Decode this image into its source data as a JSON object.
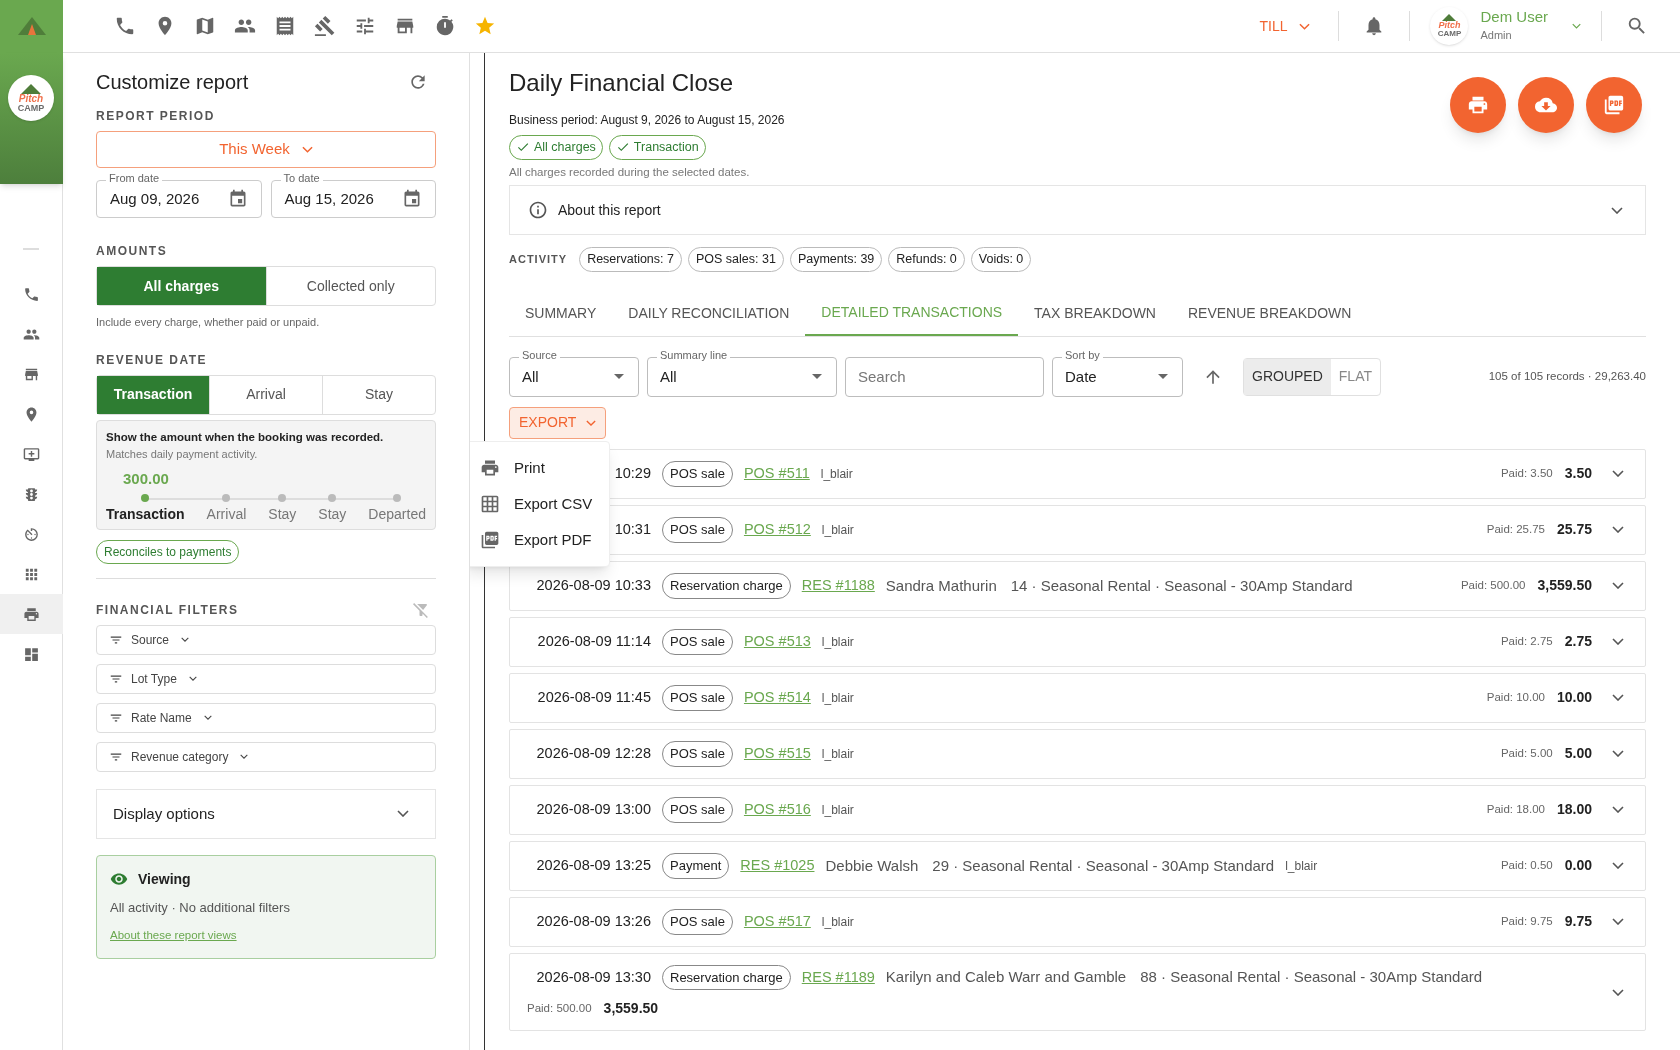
{
  "top_bar": {
    "till": "TILL",
    "user": {
      "name": "Dem User",
      "role": "Admin",
      "logo": {
        "line1": "Pitch",
        "line2": "CAMP"
      }
    }
  },
  "side_rail": {
    "logo": {
      "line1": "Pitch",
      "line2": "CAMP"
    },
    "items": [
      {
        "selected": false
      },
      {
        "selected": false
      },
      {
        "selected": false
      },
      {
        "selected": false
      },
      {
        "selected": false
      },
      {
        "selected": false
      },
      {
        "selected": false
      },
      {
        "selected": false
      },
      {
        "selected": true
      },
      {
        "selected": false
      }
    ]
  },
  "customize": {
    "title": "Customize report",
    "report_period": {
      "label": "REPORT PERIOD",
      "value": "This Week"
    },
    "from_date": {
      "label": "From date",
      "value": "Aug 09, 2026"
    },
    "to_date": {
      "label": "To date",
      "value": "Aug 15, 2026"
    },
    "amounts": {
      "label": "AMOUNTS",
      "options": [
        {
          "label": "All charges",
          "selected": true
        },
        {
          "label": "Collected only",
          "selected": false
        }
      ],
      "hint": "Include every charge, whether paid or unpaid."
    },
    "revenue_date": {
      "label": "REVENUE DATE",
      "options": [
        {
          "label": "Transaction",
          "selected": true
        },
        {
          "label": "Arrival",
          "selected": false
        },
        {
          "label": "Stay",
          "selected": false
        }
      ],
      "info": {
        "title": "Show the amount when the booking was recorded.",
        "subtitle": "Matches daily payment activity.",
        "value": "300.00",
        "stops": [
          {
            "label": "Transaction",
            "selected": true
          },
          {
            "label": "Arrival",
            "selected": false
          },
          {
            "label": "Stay",
            "selected": false
          },
          {
            "label": "Stay",
            "selected": false
          },
          {
            "label": "Departed",
            "selected": false
          }
        ]
      },
      "chip": "Reconciles to payments"
    },
    "financial_filters": {
      "label": "FINANCIAL FILTERS",
      "filters": [
        "Source",
        "Lot Type",
        "Rate Name",
        "Revenue category"
      ]
    },
    "display_options": {
      "label": "Display options",
      "expanded": false
    },
    "viewing": {
      "title": "Viewing",
      "text": "All activity · No additional filters",
      "link": "About these report views"
    }
  },
  "report": {
    "title": "Daily Financial Close",
    "period": "Business period: August 9, 2026 to August 15, 2026",
    "tags": [
      "All charges",
      "Transaction"
    ],
    "hint": "All charges recorded during the selected dates.",
    "about": {
      "label": "About this report",
      "expanded": false
    },
    "activity": {
      "label": "ACTIVITY",
      "counts": [
        "Reservations: 7",
        "POS sales: 31",
        "Payments: 39",
        "Refunds: 0",
        "Voids: 0"
      ]
    },
    "tabs": [
      {
        "label": "SUMMARY",
        "selected": false
      },
      {
        "label": "DAILY RECONCILIATION",
        "selected": false
      },
      {
        "label": "DETAILED TRANSACTIONS",
        "selected": true
      },
      {
        "label": "TAX BREAKDOWN",
        "selected": false
      },
      {
        "label": "REVENUE BREAKDOWN",
        "selected": false
      }
    ],
    "toolbar": {
      "source": {
        "label": "Source",
        "value": "All"
      },
      "summary_line": {
        "label": "Summary line",
        "value": "All"
      },
      "search": {
        "placeholder": "Search"
      },
      "sort_by": {
        "label": "Sort by",
        "value": "Date"
      },
      "view_modes": [
        {
          "label": "GROUPED",
          "selected": true
        },
        {
          "label": "FLAT",
          "selected": false
        }
      ],
      "records": "105 of 105 records · 29,263.40"
    },
    "export": {
      "label": "EXPORT",
      "expanded": true,
      "menu": [
        "Print",
        "Export CSV",
        "Export PDF"
      ]
    },
    "rows": [
      {
        "datetime": "10:29",
        "type": "POS sale",
        "ref": "POS #511",
        "user": "l_blair",
        "paid": "Paid: 3.50",
        "amount": "3.50"
      },
      {
        "datetime": "10:31",
        "type": "POS sale",
        "ref": "POS #512",
        "user": "l_blair",
        "paid": "Paid: 25.75",
        "amount": "25.75"
      },
      {
        "datetime": "2026-08-09 10:33",
        "type": "Reservation charge",
        "ref": "RES #1188",
        "name": "Sandra Mathurin",
        "detail": "14 · Seasonal Rental · Seasonal - 30Amp Standard",
        "paid": "Paid: 500.00",
        "amount": "3,559.50"
      },
      {
        "datetime": "2026-08-09 11:14",
        "type": "POS sale",
        "ref": "POS #513",
        "user": "l_blair",
        "paid": "Paid: 2.75",
        "amount": "2.75"
      },
      {
        "datetime": "2026-08-09 11:45",
        "type": "POS sale",
        "ref": "POS #514",
        "user": "l_blair",
        "paid": "Paid: 10.00",
        "amount": "10.00"
      },
      {
        "datetime": "2026-08-09 12:28",
        "type": "POS sale",
        "ref": "POS #515",
        "user": "l_blair",
        "paid": "Paid: 5.00",
        "amount": "5.00"
      },
      {
        "datetime": "2026-08-09 13:00",
        "type": "POS sale",
        "ref": "POS #516",
        "user": "l_blair",
        "paid": "Paid: 18.00",
        "amount": "18.00"
      },
      {
        "datetime": "2026-08-09 13:25",
        "type": "Payment",
        "ref": "RES #1025",
        "name": "Debbie Walsh",
        "detail": "29 · Seasonal Rental · Seasonal - 30Amp Standard",
        "user": "l_blair",
        "paid": "Paid: 0.50",
        "amount": "0.00"
      },
      {
        "datetime": "2026-08-09 13:26",
        "type": "POS sale",
        "ref": "POS #517",
        "user": "l_blair",
        "paid": "Paid: 9.75",
        "amount": "9.75"
      },
      {
        "datetime": "2026-08-09 13:30",
        "type": "Reservation charge",
        "ref": "RES #1189",
        "name": "Karilyn and Caleb Warr and Gamble",
        "detail": "88 · Seasonal Rental · Seasonal - 30Amp Standard",
        "paid": "Paid: 500.00",
        "amount": "3,559.50"
      }
    ]
  }
}
